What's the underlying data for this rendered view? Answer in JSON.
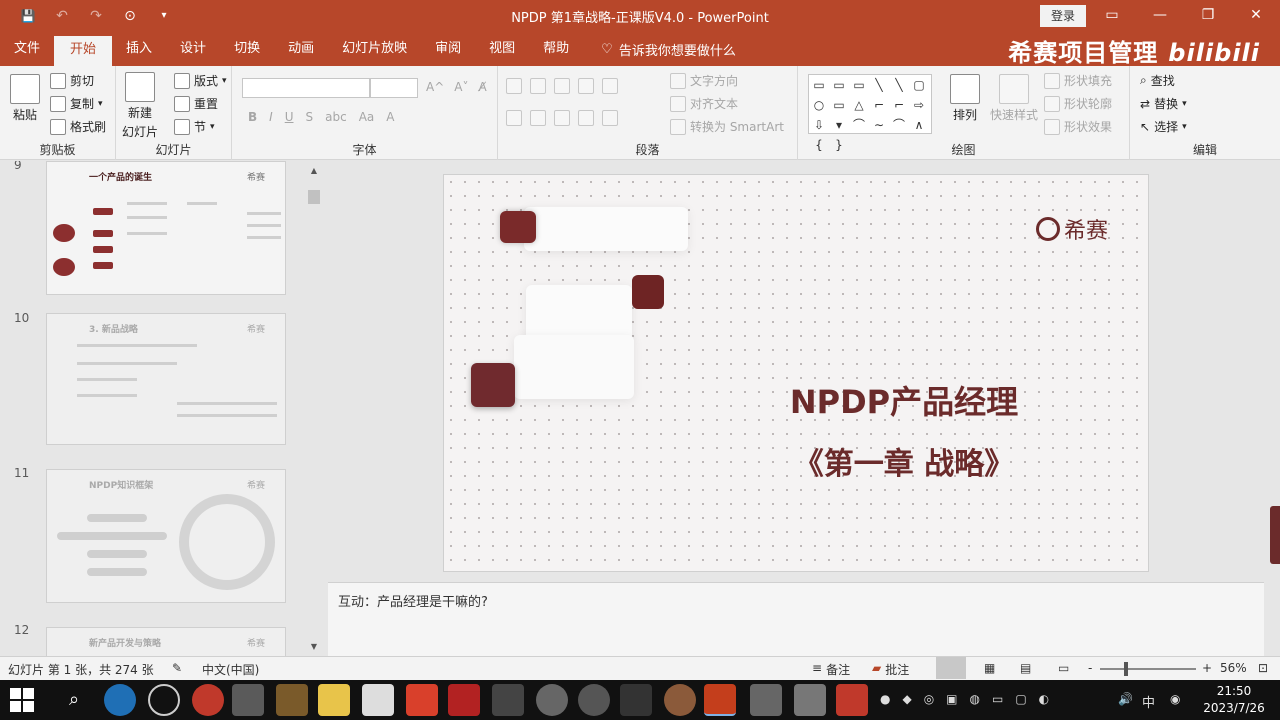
{
  "window": {
    "title": "NPDP 第1章战略-正课版V4.0  -  PowerPoint",
    "login": "登录",
    "minimize": "—",
    "restore": "❐",
    "close": "✕"
  },
  "quick_access": {
    "save": "💾",
    "undo": "↶",
    "redo": "↷",
    "present": "⊙",
    "customize": "▾"
  },
  "tabs": [
    "文件",
    "开始",
    "插入",
    "设计",
    "切换",
    "动画",
    "幻灯片放映",
    "审阅",
    "视图",
    "帮助"
  ],
  "tell_me": "告诉我你想要做什么",
  "brand": {
    "text": "希赛项目管理",
    "bili": "bilibili"
  },
  "ribbon": {
    "clipboard": {
      "label": "剪贴板",
      "paste": "粘贴",
      "cut": "剪切",
      "copy": "复制",
      "format_painter": "格式刷"
    },
    "slides": {
      "label": "幻灯片",
      "new_slide": "新建",
      "new_slide2": "幻灯片",
      "layout": "版式",
      "reset": "重置",
      "section": "节"
    },
    "font": {
      "label": "字体",
      "bold": "B",
      "italic": "I",
      "underline": "U",
      "strike": "S",
      "spacing": "abc",
      "case": "Aa"
    },
    "paragraph": {
      "label": "段落",
      "text_direction": "文字方向",
      "align_text": "对齐文本",
      "smartart": "转换为 SmartArt"
    },
    "drawing": {
      "label": "绘图",
      "arrange": "排列",
      "quick_styles": "快速样式",
      "shape_fill": "形状填充",
      "shape_outline": "形状轮廓",
      "shape_effects": "形状效果"
    },
    "editing": {
      "label": "编辑",
      "find": "查找",
      "replace": "替换",
      "select": "选择"
    }
  },
  "shapes": [
    "▭",
    "▭",
    "▭",
    "╲",
    "╲",
    "▢",
    "○",
    "▭",
    "△",
    "⌐",
    "⌐",
    "⇨",
    "⇩",
    "▾",
    "⌒",
    "∼",
    "⌒",
    "∧",
    "{",
    "}"
  ],
  "thumbnails": [
    {
      "number": "9",
      "title": "一个产品的诞生",
      "brand": "希赛"
    },
    {
      "number": "10",
      "title": "3. 新品战略",
      "brand": "希赛"
    },
    {
      "number": "11",
      "title": "NPDP知识框架",
      "brand": "希赛"
    },
    {
      "number": "12",
      "title": "新产品开发与策略",
      "brand": "希赛"
    }
  ],
  "slide": {
    "logo_text": "希赛",
    "title": "NPDP产品经理",
    "subtitle": "《第一章 战略》"
  },
  "notes": "互动：产品经理是干嘛的?",
  "status": {
    "slide_info": "幻灯片 第 1 张，共 274 张",
    "language": "中文(中国)",
    "notes_btn": "备注",
    "comments_btn": "批注",
    "zoom_minus": "-",
    "zoom_plus": "+",
    "zoom": "56%"
  },
  "taskbar": {
    "ime": "中",
    "time": "21:50",
    "date": "2023/7/26"
  },
  "colors": {
    "accent": "#b7472a",
    "slide_text": "#6b2b2b"
  }
}
